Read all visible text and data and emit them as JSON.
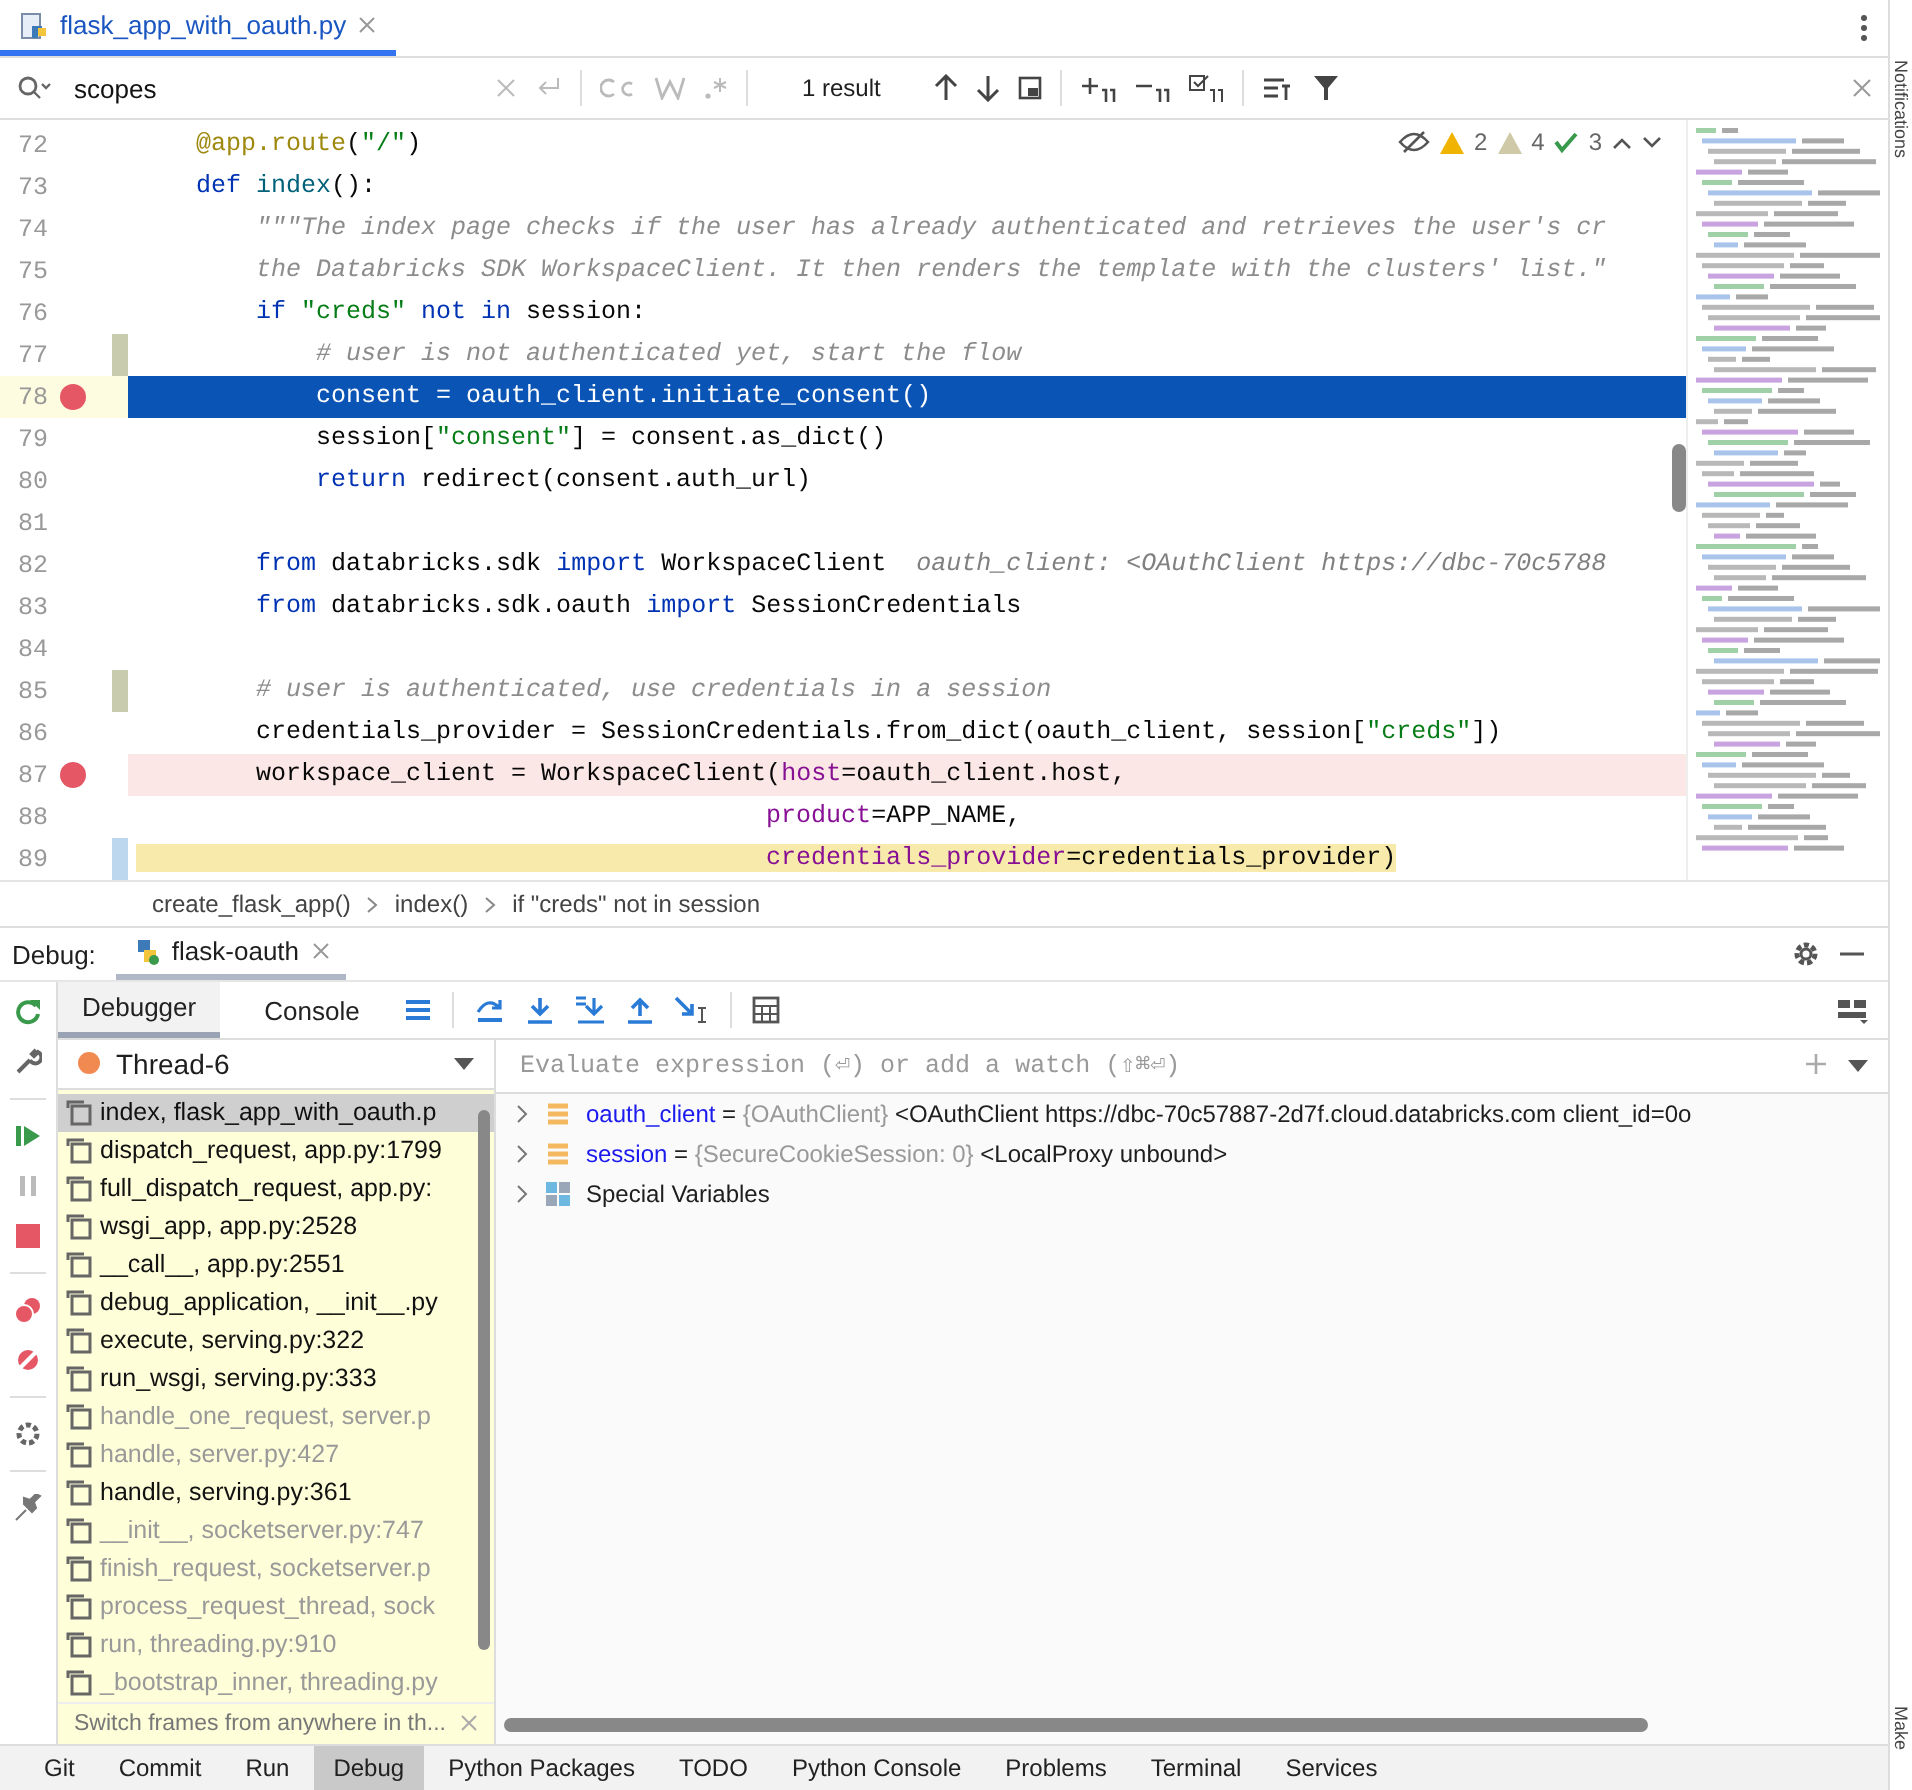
{
  "editor_tab": {
    "label": "flask_app_with_oauth.py",
    "selected": true
  },
  "search": {
    "value": "scopes",
    "result": "1 result"
  },
  "inspections": {
    "warnings": "2",
    "weak_warnings": "4",
    "checks": "3"
  },
  "editor": {
    "lines": [
      {
        "n": "72",
        "breakpoint": false,
        "current": false,
        "segs": [
          {
            "t": "    @app.route",
            "kind": "dec"
          },
          {
            "t": "(",
            "kind": "plain"
          },
          {
            "t": "\"/\"",
            "kind": "str"
          },
          {
            "t": ")",
            "kind": "plain"
          }
        ]
      },
      {
        "n": "73",
        "breakpoint": false,
        "current": false,
        "segs": [
          {
            "t": "    def ",
            "kind": "kw"
          },
          {
            "t": "index",
            "kind": "fn"
          },
          {
            "t": "():",
            "kind": "plain"
          }
        ]
      },
      {
        "n": "74",
        "breakpoint": false,
        "current": false,
        "segs": [
          {
            "t": "        \"\"\"The index page checks if the user has already authenticated and retrieves the user's cr",
            "kind": "doc"
          }
        ]
      },
      {
        "n": "75",
        "breakpoint": false,
        "current": false,
        "segs": [
          {
            "t": "        the Databricks SDK WorkspaceClient. It then renders the template with the clusters' list.\"",
            "kind": "doc"
          }
        ]
      },
      {
        "n": "76",
        "breakpoint": false,
        "current": false,
        "segs": [
          {
            "t": "        if ",
            "kind": "kw"
          },
          {
            "t": "\"creds\" ",
            "kind": "str"
          },
          {
            "t": "not in ",
            "kind": "kw"
          },
          {
            "t": "session:",
            "kind": "plain"
          }
        ]
      },
      {
        "n": "77",
        "breakpoint": false,
        "current": false,
        "color": "#c8cbad",
        "segs": [
          {
            "t": "            # user is not authenticated yet, start the flow",
            "kind": "cmt"
          }
        ]
      },
      {
        "n": "78",
        "breakpoint": true,
        "current": true,
        "segs": [
          {
            "t": "            consent = oauth_client.initiate_consent()",
            "kind": "plain"
          }
        ]
      },
      {
        "n": "79",
        "breakpoint": false,
        "current": false,
        "segs": [
          {
            "t": "            session[",
            "kind": "plain"
          },
          {
            "t": "\"consent\"",
            "kind": "str"
          },
          {
            "t": "] = consent.as_dict()",
            "kind": "plain"
          }
        ]
      },
      {
        "n": "80",
        "breakpoint": false,
        "current": false,
        "segs": [
          {
            "t": "            return ",
            "kind": "kw"
          },
          {
            "t": "redirect(consent.auth_url)",
            "kind": "plain"
          }
        ]
      },
      {
        "n": "81",
        "breakpoint": false,
        "current": false
      },
      {
        "n": "82",
        "breakpoint": false,
        "current": false,
        "segs": [
          {
            "t": "        from ",
            "kind": "kw"
          },
          {
            "t": "databricks.sdk ",
            "kind": "plain"
          },
          {
            "t": "import ",
            "kind": "kw"
          },
          {
            "t": "WorkspaceClient  ",
            "kind": "plain"
          },
          {
            "t": "oauth_client: <OAuthClient https://dbc-70c5788",
            "kind": "hint"
          }
        ]
      },
      {
        "n": "83",
        "breakpoint": false,
        "current": false,
        "segs": [
          {
            "t": "        from ",
            "kind": "kw"
          },
          {
            "t": "databricks.sdk.oauth ",
            "kind": "plain"
          },
          {
            "t": "import ",
            "kind": "kw"
          },
          {
            "t": "SessionCredentials",
            "kind": "plain"
          }
        ]
      },
      {
        "n": "84",
        "breakpoint": false,
        "current": false
      },
      {
        "n": "85",
        "breakpoint": false,
        "current": false,
        "color": "#c8cbad",
        "segs": [
          {
            "t": "        # user is authenticated, use credentials in a session",
            "kind": "cmt"
          }
        ]
      },
      {
        "n": "86",
        "breakpoint": false,
        "current": false,
        "segs": [
          {
            "t": "        credentials_provider = SessionCredentials.from_dict(oauth_client, session[",
            "kind": "plain"
          },
          {
            "t": "\"creds\"",
            "kind": "str"
          },
          {
            "t": "])",
            "kind": "plain"
          }
        ]
      },
      {
        "n": "87",
        "breakpoint": true,
        "current": false,
        "segs": [
          {
            "t": "        workspace_client = WorkspaceClient(",
            "kind": "plain"
          },
          {
            "t": "host",
            "kind": "param"
          },
          {
            "t": "=oauth_client.host,",
            "kind": "plain"
          }
        ]
      },
      {
        "n": "88",
        "breakpoint": false,
        "current": false,
        "segs": [
          {
            "t": "                                          product",
            "kind": "param"
          },
          {
            "t": "=APP_NAME,",
            "kind": "plain"
          }
        ]
      },
      {
        "n": "89",
        "breakpoint": false,
        "current": false,
        "color": "#bdd7ee",
        "segs": [
          {
            "t": "                                          credentials_provider",
            "kind": "param_hl"
          },
          {
            "t": "=credentials_provider)",
            "kind": "hl"
          }
        ]
      }
    ]
  },
  "breadcrumbs": [
    "create_flask_app()",
    "index()",
    "if \"creds\" not in session"
  ],
  "debug": {
    "label": "Debug:",
    "session_tab": {
      "label": "flask-oauth",
      "selected": true
    },
    "tabs": [
      {
        "label": "Debugger",
        "selected": true
      },
      {
        "label": "Console",
        "selected": false
      }
    ],
    "thread": "Thread-6",
    "evaluate": {
      "placeholder": "Evaluate expression (⏎) or add a watch (⇧⌘⏎)"
    },
    "frames": [
      {
        "label": "index, flask_app_with_oauth.p",
        "selected": true,
        "dimmed": false
      },
      {
        "label": "dispatch_request, app.py:1799",
        "selected": false,
        "dimmed": false
      },
      {
        "label": "full_dispatch_request, app.py:",
        "selected": false,
        "dimmed": false
      },
      {
        "label": "wsgi_app, app.py:2528",
        "selected": false,
        "dimmed": false
      },
      {
        "label": "__call__, app.py:2551",
        "selected": false,
        "dimmed": false
      },
      {
        "label": "debug_application, __init__.py",
        "selected": false,
        "dimmed": false
      },
      {
        "label": "execute, serving.py:322",
        "selected": false,
        "dimmed": false
      },
      {
        "label": "run_wsgi, serving.py:333",
        "selected": false,
        "dimmed": false
      },
      {
        "label": "handle_one_request, server.p",
        "selected": false,
        "dimmed": true
      },
      {
        "label": "handle, server.py:427",
        "selected": false,
        "dimmed": true
      },
      {
        "label": "handle, serving.py:361",
        "selected": false,
        "dimmed": false
      },
      {
        "label": "__init__, socketserver.py:747",
        "selected": false,
        "dimmed": true
      },
      {
        "label": "finish_request, socketserver.p",
        "selected": false,
        "dimmed": true
      },
      {
        "label": "process_request_thread, sock",
        "selected": false,
        "dimmed": true
      },
      {
        "label": "run, threading.py:910",
        "selected": false,
        "dimmed": true
      },
      {
        "label": "_bootstrap_inner, threading.py",
        "selected": false,
        "dimmed": true
      }
    ],
    "frames_hint": "Switch frames from anywhere in th...",
    "variables": [
      {
        "kind": "var",
        "name": "oauth_client",
        "eq": "=",
        "type": "{OAuthClient}",
        "value": "<OAuthClient https://dbc-70c57887-2d7f.cloud.databricks.com client_id=0o"
      },
      {
        "kind": "var",
        "name": "session",
        "eq": "=",
        "type": "{SecureCookieSession: 0}",
        "value": "<LocalProxy unbound>"
      },
      {
        "kind": "group",
        "name": "Special Variables"
      }
    ]
  },
  "tool_windows": [
    {
      "label": "Git",
      "selected": false
    },
    {
      "label": "Commit",
      "selected": false
    },
    {
      "label": "Run",
      "selected": false
    },
    {
      "label": "Debug",
      "selected": true
    },
    {
      "label": "Python Packages",
      "selected": false
    },
    {
      "label": "TODO",
      "selected": false
    },
    {
      "label": "Python Console",
      "selected": false
    },
    {
      "label": "Problems",
      "selected": false
    },
    {
      "label": "Terminal",
      "selected": false
    },
    {
      "label": "Services",
      "selected": false
    }
  ],
  "right_strip": [
    "Notifications",
    "Make"
  ]
}
